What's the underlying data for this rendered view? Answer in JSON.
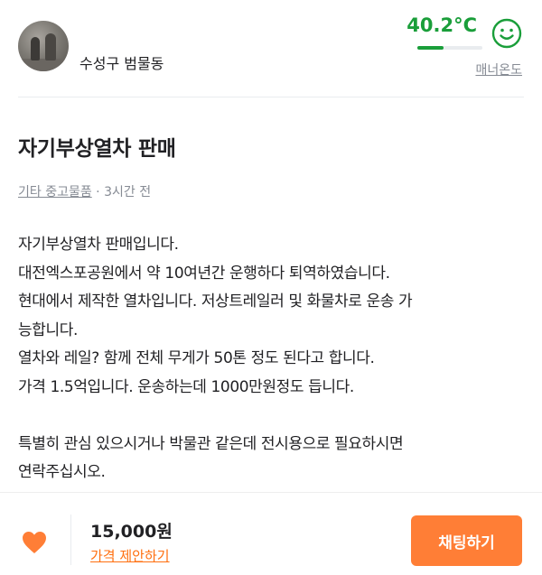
{
  "seller": {
    "location": "수성구 범물동",
    "manner_temp": "40.2°C",
    "manner_temp_level": 0.402,
    "manner_label": "매너온도",
    "face_icon": "smile-face-icon"
  },
  "colors": {
    "accent": "#ff7e36",
    "temp_green": "#1a9e3a",
    "muted": "#868b94"
  },
  "post": {
    "title": "자기부상열차 판매",
    "category": "기타 중고물품",
    "separator": " · ",
    "time": "3시간 전",
    "description": "자기부상열차 판매입니다.\n대전엑스포공원에서 약 10여년간 운행하다 퇴역하였습니다.\n현대에서 제작한 열차입니다. 저상트레일러 및 화물차로 운송 가\n능합니다.\n열차와 레일? 함께 전체 무게가 50톤 정도 된다고 합니다.\n가격 1.5억입니다. 운송하는데 1000만원정도 듭니다.\n\n특별히 관심 있으시거나 박물관 같은데 전시용으로 필요하시면\n연락주십시오."
  },
  "bottom_bar": {
    "heart_icon": "heart-icon",
    "price": "15,000원",
    "offer_label": "가격 제안하기",
    "chat_label": "채팅하기"
  }
}
